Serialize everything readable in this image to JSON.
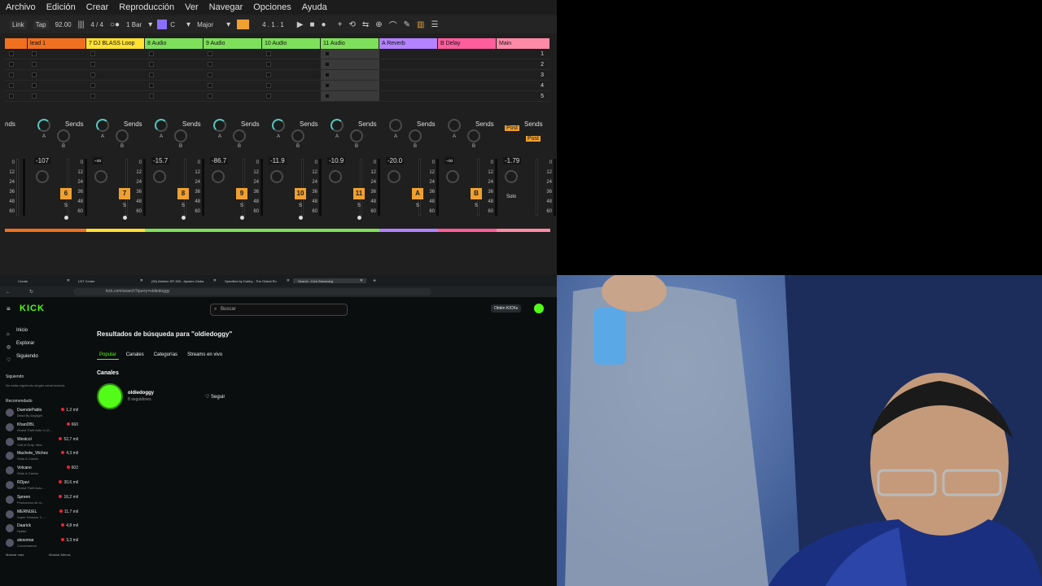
{
  "daw": {
    "menu": [
      "Archivo",
      "Edición",
      "Crear",
      "Reproducción",
      "Ver",
      "Navegar",
      "Opciones",
      "Ayuda"
    ],
    "transport": {
      "link": "Link",
      "tap": "Tap",
      "tempo": "92.00",
      "signature": "4 / 4",
      "quant": "1 Bar",
      "key": "C",
      "scale": "Major",
      "position": "4 . 1 . 1"
    },
    "tracks": [
      {
        "name": "",
        "color": "#f07020",
        "vol": "",
        "num": "",
        "partial": true
      },
      {
        "name": "lead 1",
        "color": "#f07020",
        "vol": "-107",
        "num": "6"
      },
      {
        "name": "7 DJ BLASS Loop",
        "color": "#ffe033",
        "vol": "-∞",
        "num": "7"
      },
      {
        "name": "8 Audio",
        "color": "#7ee05a",
        "vol": "-15.7",
        "num": "8"
      },
      {
        "name": "9 Audio",
        "color": "#7ee05a",
        "vol": "-86.7",
        "num": "9"
      },
      {
        "name": "10 Audio",
        "color": "#7ee05a",
        "vol": "-11.9",
        "num": "10"
      },
      {
        "name": "11 Audio",
        "color": "#7ee05a",
        "vol": "-10.9",
        "num": "11"
      },
      {
        "name": "A Reverb",
        "color": "#b282ff",
        "vol": "-20.0",
        "num": "A"
      },
      {
        "name": "B Delay",
        "color": "#ff5e9c",
        "vol": "-∞",
        "num": "B"
      },
      {
        "name": "Main",
        "color": "#ff8aa8",
        "vol": "-1.79",
        "num": ""
      }
    ],
    "sends_label": "Sends",
    "sends_partial": "nds",
    "knob_a": "A",
    "knob_b": "B",
    "scale_ticks": [
      "0",
      "12",
      "24",
      "36",
      "48",
      "60"
    ],
    "solo": "S",
    "post": "Post",
    "solo_main": "Solo",
    "scenes": [
      "1",
      "2",
      "3",
      "4",
      "5"
    ]
  },
  "browser": {
    "tabs": [
      {
        "label": "Create"
      },
      {
        "label": "LNT Center"
      },
      {
        "label": "(90) Ableton SP-303 - Ajustes Globa"
      },
      {
        "label": "Specified by Dubby - The Global Ro"
      },
      {
        "label": "Search - Kick Streaming",
        "active": true
      }
    ],
    "url": "kick.com/search?query=oldiedoggy",
    "logo": "KICK",
    "search_placeholder": "Buscar",
    "obten": "Obtén KICKs",
    "nav": [
      {
        "label": "Inicio",
        "icon": "⌂"
      },
      {
        "label": "Explorar",
        "icon": "◎"
      },
      {
        "label": "Siguiendo",
        "icon": "♡"
      }
    ],
    "following_title": "Siguiendo",
    "following_empty": "No estás siguiendo ningún canal todavía.",
    "recommended_title": "Recomendado",
    "recommended": [
      {
        "name": "DuendePablo",
        "game": "Dead By Daylight",
        "viewers": "1,2 mil"
      },
      {
        "name": "KhanDBL",
        "game": "Grand Theft Auto V (G...",
        "viewers": "660"
      },
      {
        "name": "Westcol",
        "game": "Call of Duty: War...",
        "viewers": "52,7 mil"
      },
      {
        "name": "Machete_Vilchez",
        "game": "Slots & Casino",
        "viewers": "4,3 mil"
      },
      {
        "name": "Volcano",
        "game": "Slots & Casino",
        "viewers": "602"
      },
      {
        "name": "RDjavi",
        "game": "Grand Theft Auto...",
        "viewers": "30,6 mil"
      },
      {
        "name": "Spreen",
        "game": "Producción de m...",
        "viewers": "16,2 mil"
      },
      {
        "name": "MERNUEL",
        "game": "Super Seducer 2 -...",
        "viewers": "11,7 mil"
      },
      {
        "name": "Daarick",
        "game": "Hytale",
        "viewers": "4,8 mil"
      },
      {
        "name": "alexomar",
        "game": "Conversando",
        "viewers": "3,3 mil"
      }
    ],
    "show_more": "Mostrar más",
    "show_less": "Mostrar Menos",
    "results_title": "Resultados de búsqueda para \"oldiedoggy\"",
    "filter_tabs": [
      "Popular",
      "Canales",
      "Categorías",
      "Streams en vivo"
    ],
    "channels_title": "Canales",
    "channel": {
      "name": "oldiedoggy",
      "followers": "8 seguidores",
      "follow": "Seguir"
    }
  }
}
